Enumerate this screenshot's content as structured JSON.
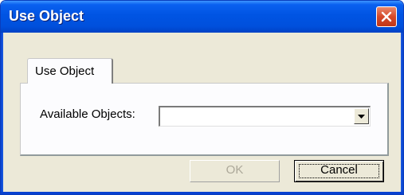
{
  "window": {
    "title": "Use Object",
    "close_icon": "close-x-icon",
    "title_gradient": "#0054e3",
    "frame_color": "#0a3dbd",
    "close_color": "#d5492a"
  },
  "tabs": [
    {
      "label": "Use Object",
      "selected": true
    }
  ],
  "form": {
    "available_objects_label": "Available Objects:",
    "available_objects_value": "",
    "dropdown_icon": "chevron-down-icon"
  },
  "buttons": {
    "ok_label": "OK",
    "ok_enabled": false,
    "cancel_label": "Cancel",
    "cancel_focused": true
  },
  "colors": {
    "dialog_background": "#ece9d8",
    "panel_background": "#fcfcfe",
    "disabled_text": "#aca899"
  }
}
